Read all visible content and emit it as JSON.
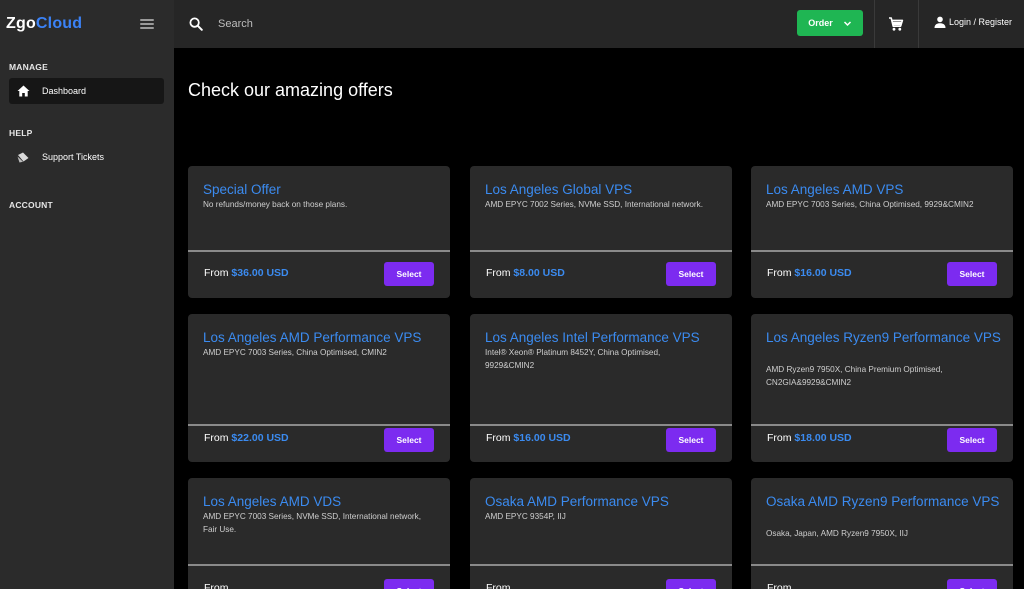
{
  "app": {
    "logo_first": "Zgo",
    "logo_second": "Cloud",
    "brand_color": "#3b82f6"
  },
  "sidebar": {
    "sections": [
      {
        "label": "MANAGE",
        "items": [
          {
            "label": "Dashboard",
            "icon": "home-icon",
            "active": true
          }
        ]
      },
      {
        "label": "HELP",
        "items": [
          {
            "label": "Support Tickets",
            "icon": "ticket-icon",
            "active": false
          }
        ]
      },
      {
        "label": "ACCOUNT",
        "items": []
      }
    ]
  },
  "topbar": {
    "search_placeholder": "Search",
    "order_label": "Order",
    "order_color": "#1fb653",
    "login_label": "Login / Register"
  },
  "main": {
    "heading": "Check our amazing offers",
    "price_prefix": "From",
    "select_label": "Select",
    "select_color": "#7c2bf0",
    "offers": [
      {
        "title": "Special Offer",
        "desc": "No refunds/money back on those plans.",
        "price": "$36.00 USD"
      },
      {
        "title": "Los Angeles Global VPS",
        "desc": "AMD EPYC 7002 Series, NVMe SSD, International network.",
        "price": "$8.00 USD"
      },
      {
        "title": "Los Angeles AMD VPS",
        "desc": "AMD EPYC 7003 Series, China Optimised, 9929&CMIN2",
        "price": "$16.00 USD"
      },
      {
        "title": "Los Angeles AMD Performance VPS",
        "desc": "AMD EPYC 7003 Series, China Optimised, CMIN2",
        "price": "$22.00 USD"
      },
      {
        "title": "Los Angeles Intel Performance VPS",
        "desc": "Intel® Xeon® Platinum 8452Y, China Optimised, 9929&CMIN2",
        "price": "$16.00 USD"
      },
      {
        "title": "Los Angeles Ryzen9 Performance VPS",
        "desc": "AMD Ryzen9 7950X, China Premium Optimised, CN2GIA&9929&CMIN2",
        "price": "$18.00 USD"
      },
      {
        "title": "Los Angeles AMD VDS",
        "desc": "AMD EPYC 7003 Series, NVMe SSD, International network, Fair Use.",
        "price": ""
      },
      {
        "title": "Osaka AMD Performance VPS",
        "desc": "AMD EPYC 9354P, IIJ",
        "price": ""
      },
      {
        "title": "Osaka AMD Ryzen9 Performance VPS",
        "desc": "Osaka, Japan, AMD Ryzen9 7950X, IIJ",
        "price": ""
      }
    ]
  }
}
